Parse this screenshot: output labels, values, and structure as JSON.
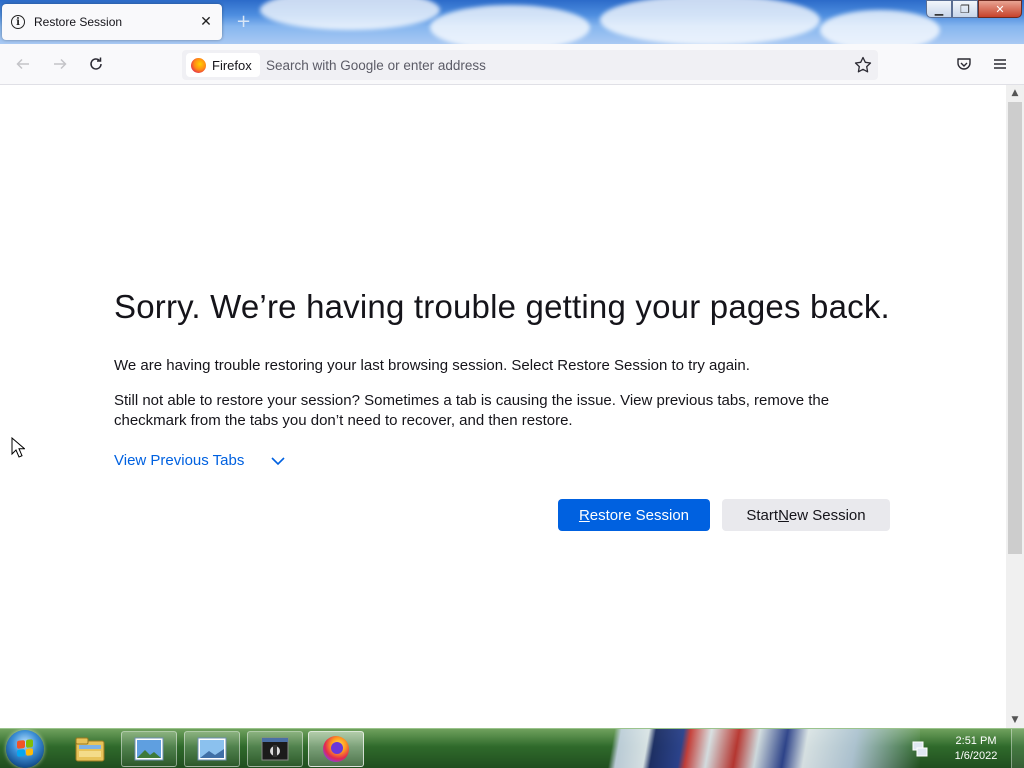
{
  "browser": {
    "tab": {
      "title": "Restore Session",
      "info_icon": "info-icon",
      "close_glyph": "✕"
    },
    "new_tab_glyph": "+",
    "window_controls": {
      "minimize": "▁",
      "restore": "❐",
      "close": "✕"
    },
    "nav": {
      "identity_label": "Firefox",
      "url_placeholder": "Search with Google or enter address",
      "icons": [
        "back-icon",
        "forward-icon",
        "reload-icon",
        "bookmark-star-icon",
        "pocket-icon",
        "menu-icon"
      ]
    }
  },
  "page": {
    "heading": "Sorry. We’re having trouble getting your pages back.",
    "paragraph1": "We are having trouble restoring your last browsing session. Select Restore Session to try again.",
    "paragraph2": "Still not able to restore your session? Sometimes a tab is causing the issue. View previous tabs, remove the checkmark from the tabs you don’t need to recover, and then restore.",
    "view_previous_tabs": "View Previous Tabs",
    "restore_button": {
      "pre": "",
      "key": "R",
      "post": "estore Session"
    },
    "new_session_button": {
      "pre": "Start ",
      "key": "N",
      "post": "ew Session"
    },
    "accent_color": "#0061e0"
  },
  "taskbar": {
    "time": "2:51 PM",
    "date": "1/6/2022",
    "items": [
      "windows-explorer-icon",
      "image-viewer-icon",
      "picture-icon",
      "app-icon",
      "firefox-icon"
    ]
  }
}
